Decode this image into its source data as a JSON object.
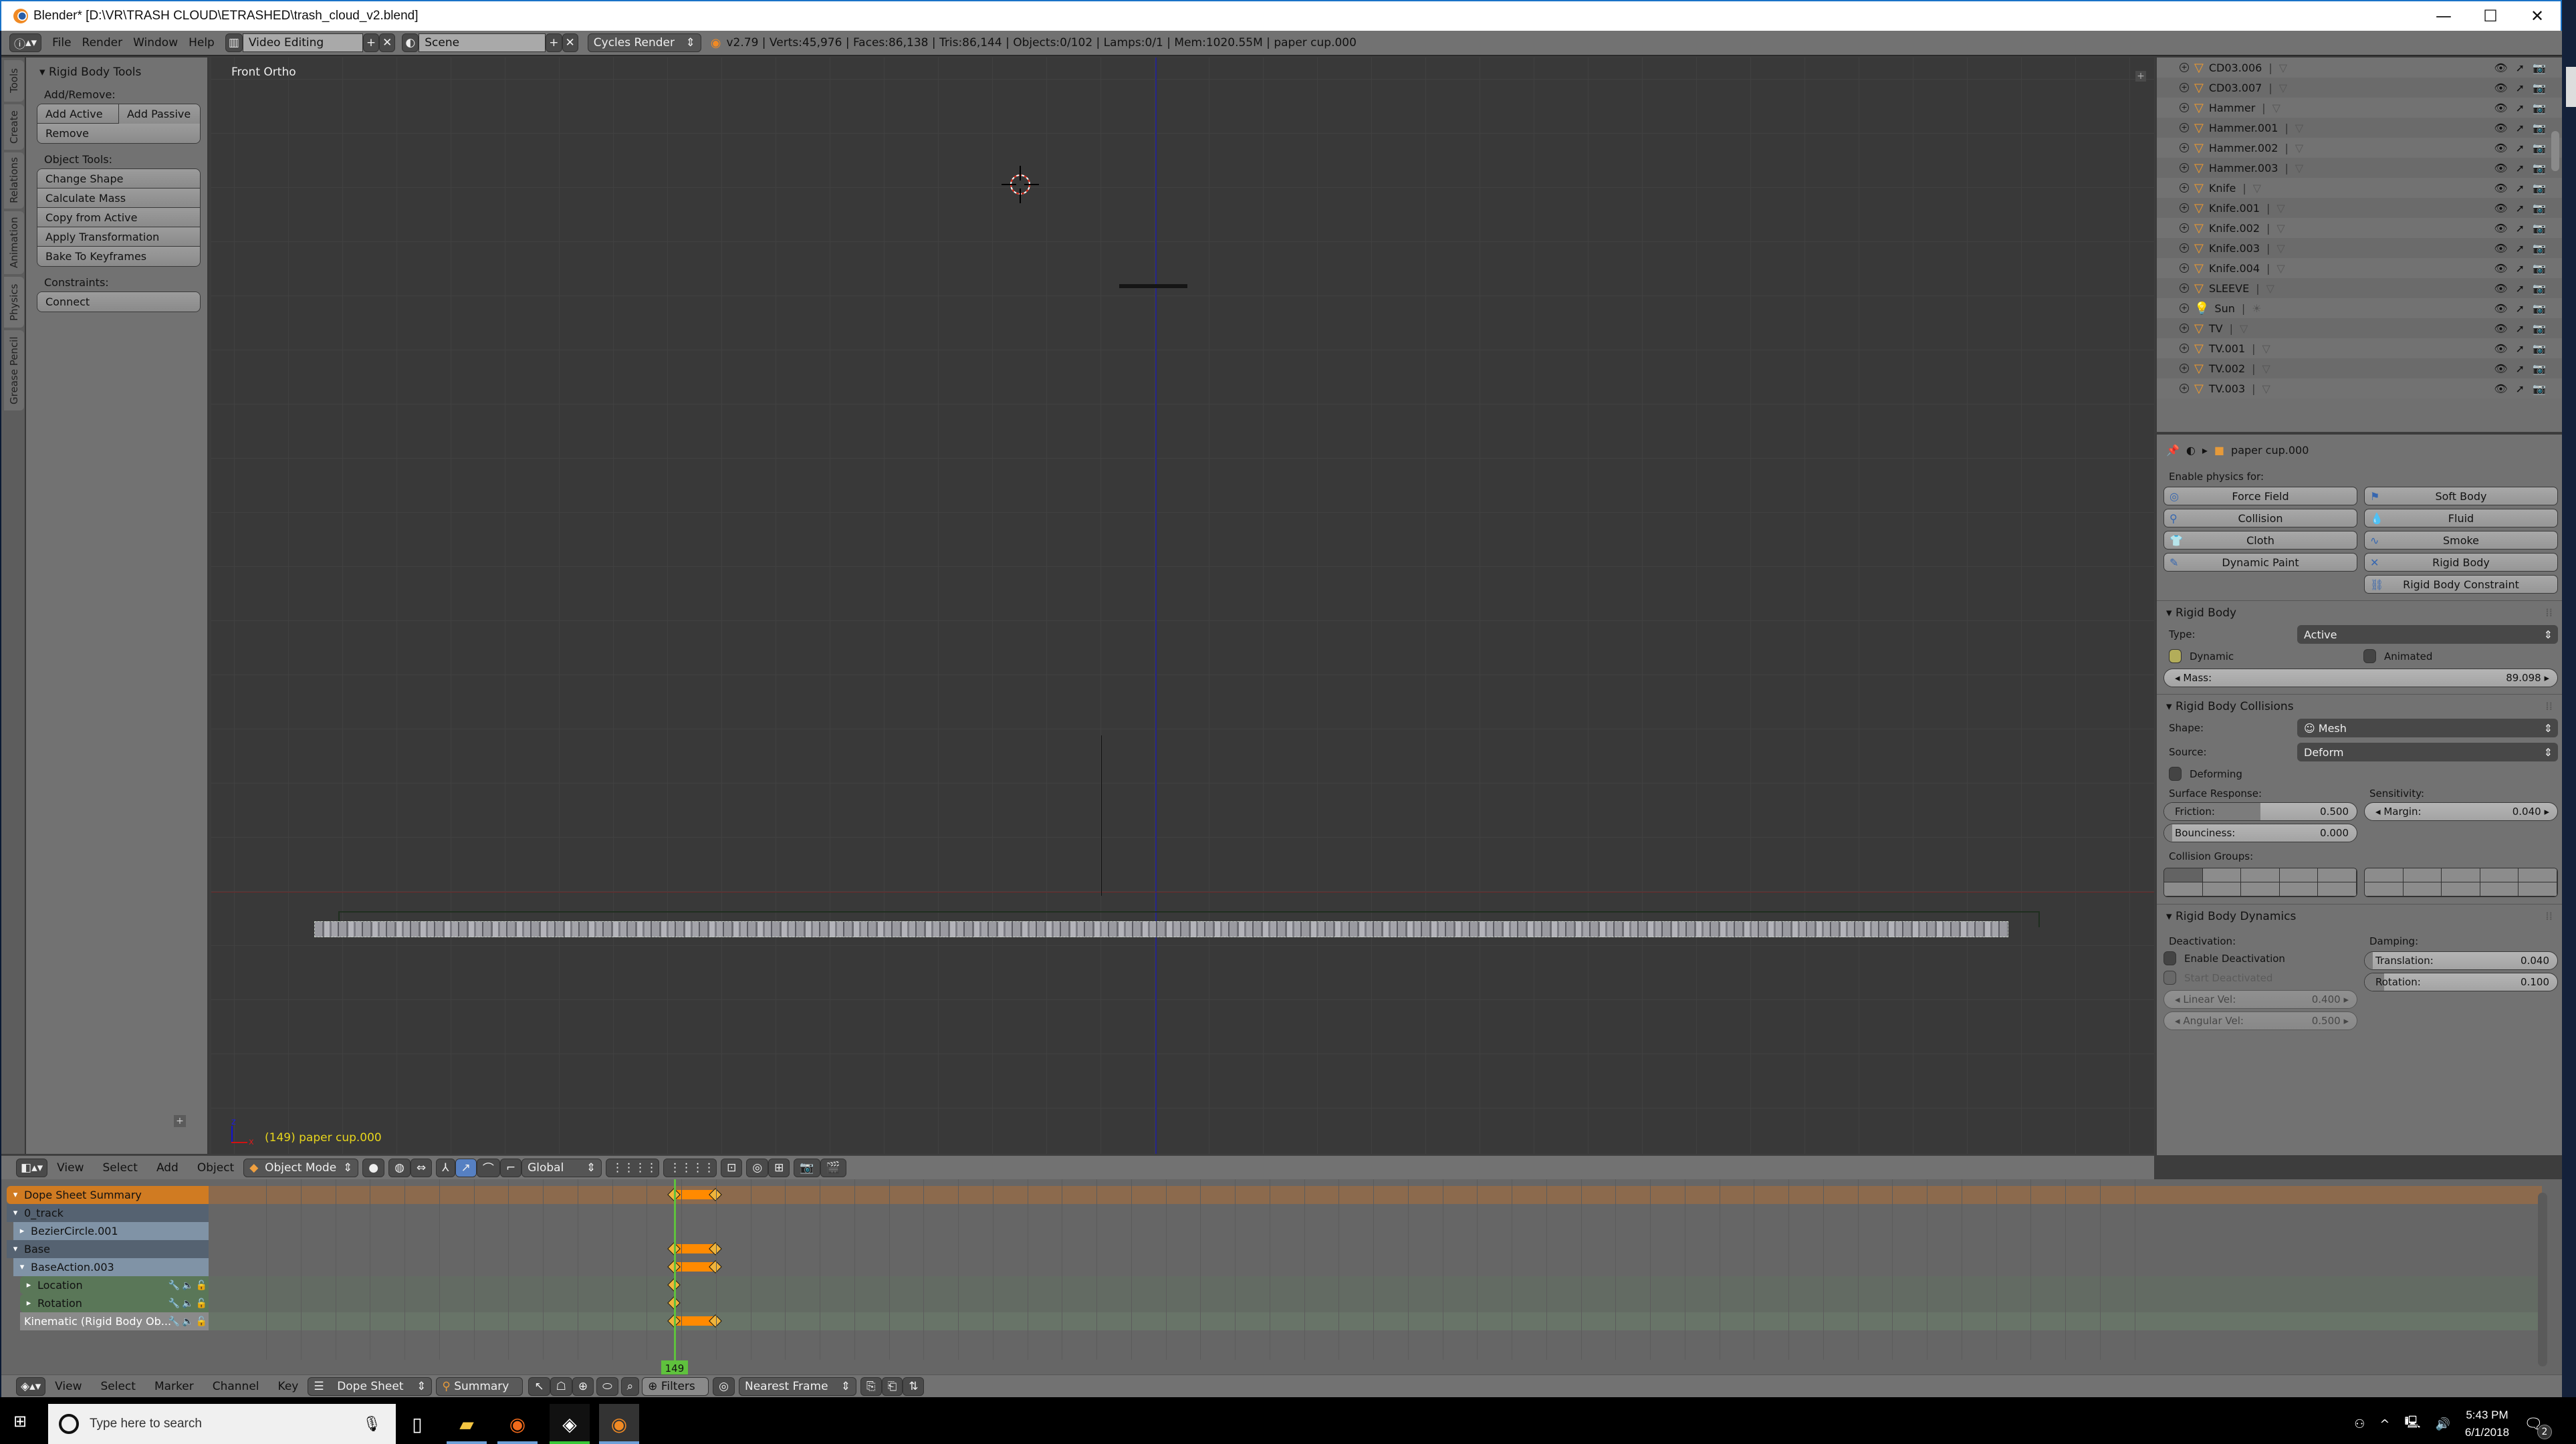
{
  "window": {
    "title": "Blender* [D:\\VR\\TRASH CLOUD\\ETRASHED\\trash_cloud_v2.blend]",
    "controls": [
      "minimize",
      "maximize",
      "close"
    ]
  },
  "info_header": {
    "menus": [
      "File",
      "Render",
      "Window",
      "Help"
    ],
    "layout": "Video Editing",
    "scene": "Scene",
    "engine": "Cycles Render",
    "stats": "v2.79 | Verts:45,976 | Faces:86,138 | Tris:86,144 | Objects:0/102 | Lamps:0/1 | Mem:1020.55M | paper cup.000"
  },
  "toolshelf": {
    "tabs": [
      "Tools",
      "Create",
      "Relations",
      "Animation",
      "Physics",
      "Grease Pencil"
    ],
    "active_tab": "Physics",
    "panel_title": "Rigid Body Tools",
    "add_remove_label": "Add/Remove:",
    "add_active": "Add Active",
    "add_passive": "Add Passive",
    "remove": "Remove",
    "object_tools_label": "Object Tools:",
    "object_tools": [
      "Change Shape",
      "Calculate Mass",
      "Copy from Active",
      "Apply Transformation",
      "Bake To Keyframes"
    ],
    "constraints_label": "Constraints:",
    "connect": "Connect"
  },
  "viewport": {
    "view_label": "Front Ortho",
    "status": "(149) paper cup.000",
    "axis_z": "z",
    "axis_x": "x",
    "header": {
      "menus": [
        "View",
        "Select",
        "Add",
        "Object"
      ],
      "mode": "Object Mode",
      "orientation": "Global"
    }
  },
  "outliner": {
    "items": [
      {
        "name": "CD03.006",
        "type": "mesh"
      },
      {
        "name": "CD03.007",
        "type": "mesh"
      },
      {
        "name": "Hammer",
        "type": "mesh"
      },
      {
        "name": "Hammer.001",
        "type": "mesh"
      },
      {
        "name": "Hammer.002",
        "type": "mesh"
      },
      {
        "name": "Hammer.003",
        "type": "mesh"
      },
      {
        "name": "Knife",
        "type": "mesh"
      },
      {
        "name": "Knife.001",
        "type": "mesh"
      },
      {
        "name": "Knife.002",
        "type": "mesh"
      },
      {
        "name": "Knife.003",
        "type": "mesh"
      },
      {
        "name": "Knife.004",
        "type": "mesh"
      },
      {
        "name": "SLEEVE",
        "type": "mesh"
      },
      {
        "name": "Sun",
        "type": "lamp"
      },
      {
        "name": "TV",
        "type": "mesh"
      },
      {
        "name": "TV.001",
        "type": "mesh"
      },
      {
        "name": "TV.002",
        "type": "mesh"
      },
      {
        "name": "TV.003",
        "type": "mesh"
      }
    ]
  },
  "properties": {
    "context_object": "paper cup.000",
    "enable_physics_label": "Enable physics for:",
    "physics_buttons": [
      {
        "label": "Force Field",
        "icon": "force-field-icon",
        "glyph": "◎"
      },
      {
        "label": "Soft Body",
        "icon": "soft-body-icon",
        "glyph": "⚑"
      },
      {
        "label": "Collision",
        "icon": "collision-icon",
        "glyph": "⚲"
      },
      {
        "label": "Fluid",
        "icon": "fluid-icon",
        "glyph": "💧"
      },
      {
        "label": "Cloth",
        "icon": "cloth-icon",
        "glyph": "👕"
      },
      {
        "label": "Smoke",
        "icon": "smoke-icon",
        "glyph": "∿"
      },
      {
        "label": "Dynamic Paint",
        "icon": "dynamic-paint-icon",
        "glyph": "✎"
      },
      {
        "label": "Rigid Body",
        "icon": "rigid-body-icon",
        "glyph": "✕"
      },
      {
        "label": "",
        "icon": "",
        "glyph": ""
      },
      {
        "label": "Rigid Body Constraint",
        "icon": "chain-link-icon",
        "glyph": "⛓"
      }
    ],
    "rigid_body": {
      "title": "Rigid Body",
      "type_label": "Type:",
      "type_value": "Active",
      "dynamic_label": "Dynamic",
      "dynamic_checked": true,
      "animated_label": "Animated",
      "animated_checked": false,
      "mass_label": "Mass:",
      "mass_value": "89.098"
    },
    "collisions": {
      "title": "Rigid Body Collisions",
      "shape_label": "Shape:",
      "shape_value": "Mesh",
      "source_label": "Source:",
      "source_value": "Deform",
      "deforming_label": "Deforming",
      "deforming_checked": false,
      "surface_response_label": "Surface Response:",
      "sensitivity_label": "Sensitivity:",
      "friction_label": "Friction:",
      "friction_value": "0.500",
      "friction_fraction": 0.5,
      "bounciness_label": "Bounciness:",
      "bounciness_value": "0.000",
      "bounciness_fraction": 0.0,
      "margin_label": "Margin:",
      "margin_value": "0.040",
      "collision_groups_label": "Collision Groups:",
      "active_group": 1
    },
    "dynamics": {
      "title": "Rigid Body Dynamics",
      "deactivation_label": "Deactivation:",
      "damping_label": "Damping:",
      "enable_deactivation_label": "Enable Deactivation",
      "enable_deactivation_checked": false,
      "start_deactivated_label": "Start Deactivated",
      "linear_vel_label": "Linear Vel:",
      "linear_vel_value": "0.400",
      "angular_vel_label": "Angular Vel:",
      "angular_vel_value": "0.500",
      "translation_label": "Translation:",
      "translation_value": "0.040",
      "translation_fraction": 0.04,
      "rotation_label": "Rotation:",
      "rotation_value": "0.100",
      "rotation_fraction": 0.1
    }
  },
  "dopesheet": {
    "channels": [
      {
        "label": "Dope Sheet Summary",
        "kind": "summary",
        "keys": [
          149,
          155
        ]
      },
      {
        "label": "0_track",
        "kind": "object",
        "keys": []
      },
      {
        "label": "BezierCircle.001",
        "kind": "action",
        "keys": []
      },
      {
        "label": "Base",
        "kind": "object",
        "keys": [
          149,
          155
        ]
      },
      {
        "label": "BaseAction.003",
        "kind": "action",
        "keys": [
          149,
          155
        ]
      },
      {
        "label": "Location",
        "kind": "group",
        "keys": [
          149
        ]
      },
      {
        "label": "Rotation",
        "kind": "group",
        "keys": [
          149
        ]
      },
      {
        "label": "Kinematic (Rigid Body Ob...",
        "kind": "fcurve",
        "keys": [
          149,
          155
        ]
      }
    ],
    "current_frame": 149,
    "frame_range_start": 90,
    "frame_range_end": 360,
    "frame_tick_step": 5,
    "preview_range": [
      105,
      165
    ],
    "header": {
      "menus": [
        "View",
        "Select",
        "Marker",
        "Channel",
        "Key"
      ],
      "editor_mode": "Dope Sheet",
      "summary_label": "Summary",
      "filters_label": "Filters",
      "snap": "Nearest Frame"
    }
  },
  "taskbar": {
    "search_placeholder": "Type here to search",
    "time": "5:43 PM",
    "date": "6/1/2018",
    "notification_count": "2",
    "apps": [
      "task-view",
      "file-explorer",
      "firefox",
      "unity",
      "blender"
    ]
  }
}
